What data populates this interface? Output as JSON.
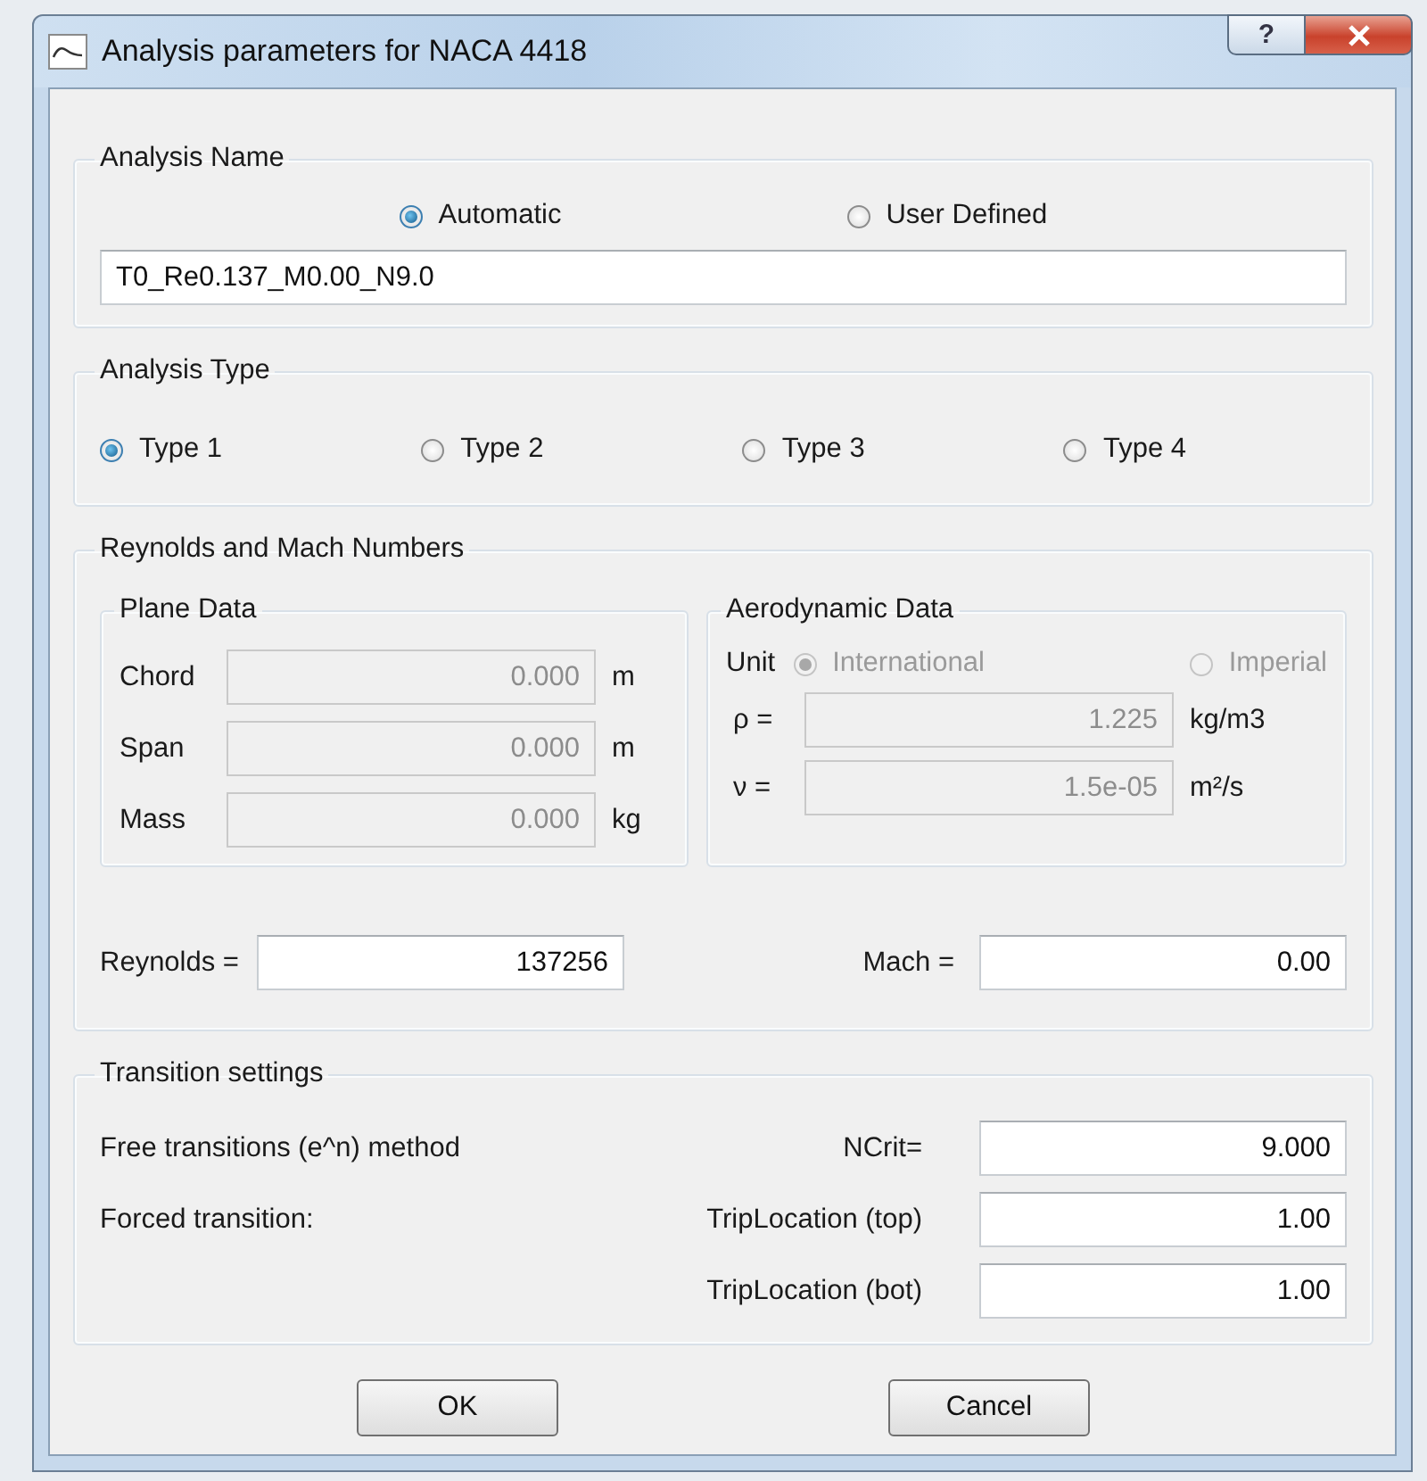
{
  "window": {
    "title": "Analysis parameters for NACA 4418",
    "help": "?"
  },
  "analysis_name": {
    "title": "Analysis Name",
    "options": [
      {
        "label": "Automatic",
        "selected": true
      },
      {
        "label": "User Defined",
        "selected": false
      }
    ],
    "value": "T0_Re0.137_M0.00_N9.0"
  },
  "analysis_type": {
    "title": "Analysis Type",
    "options": [
      {
        "label": "Type 1",
        "selected": true
      },
      {
        "label": "Type 2",
        "selected": false
      },
      {
        "label": "Type 3",
        "selected": false
      },
      {
        "label": "Type 4",
        "selected": false
      }
    ]
  },
  "reynolds_mach": {
    "title": "Reynolds and Mach Numbers",
    "plane_data": {
      "title": "Plane Data",
      "fields": [
        {
          "label": "Chord",
          "value": "0.000",
          "unit": "m",
          "disabled": true
        },
        {
          "label": "Span",
          "value": "0.000",
          "unit": "m",
          "disabled": true
        },
        {
          "label": "Mass",
          "value": "0.000",
          "unit": "kg",
          "disabled": true
        }
      ]
    },
    "aero_data": {
      "title": "Aerodynamic Data",
      "unit_label": "Unit",
      "units": [
        {
          "label": "International",
          "selected": true,
          "disabled": true
        },
        {
          "label": "Imperial",
          "selected": false,
          "disabled": true
        }
      ],
      "fields": [
        {
          "label": "ρ =",
          "value": "1.225",
          "unit": "kg/m3",
          "disabled": true
        },
        {
          "label": "ν =",
          "value": "1.5e-05",
          "unit": "m²/s",
          "disabled": true
        }
      ]
    },
    "reynolds": {
      "label": "Reynolds =",
      "value": "137256"
    },
    "mach": {
      "label": "Mach =",
      "value": "0.00"
    }
  },
  "transition": {
    "title": "Transition settings",
    "rows": [
      {
        "text": "Free transitions (e^n) method",
        "label": "NCrit=",
        "value": "9.000"
      },
      {
        "text": "Forced transition:",
        "label": "TripLocation (top)",
        "value": "1.00"
      },
      {
        "label": "TripLocation (bot)",
        "value": "1.00"
      }
    ]
  },
  "buttons": [
    "OK",
    "Cancel"
  ]
}
